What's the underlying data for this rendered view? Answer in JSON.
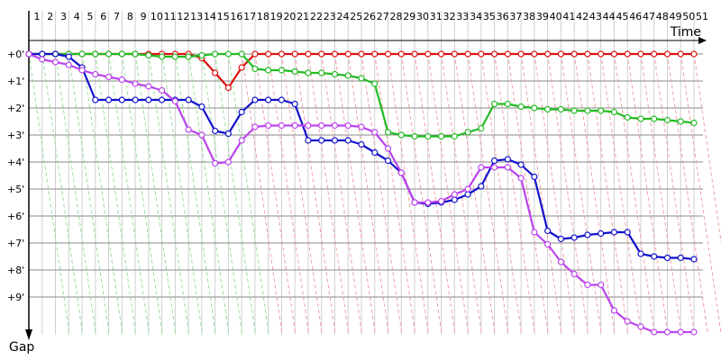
{
  "chart_data": {
    "type": "line",
    "title": "",
    "xlabel": "Time",
    "ylabel": "Gap",
    "x_tick_labels": [
      "1",
      "2",
      "3",
      "4",
      "5",
      "6",
      "7",
      "8",
      "9",
      "10",
      "11",
      "12",
      "13",
      "14",
      "15",
      "16",
      "17",
      "18",
      "19",
      "20",
      "21",
      "22",
      "23",
      "24",
      "25",
      "26",
      "27",
      "28",
      "29",
      "30",
      "31",
      "32",
      "33",
      "34",
      "35",
      "36",
      "37",
      "38",
      "39",
      "40",
      "41",
      "42",
      "43",
      "44",
      "45",
      "46",
      "47",
      "48",
      "49",
      "50",
      "51"
    ],
    "y_tick_labels": [
      "+0'",
      "+1'",
      "+2'",
      "+3'",
      "+4'",
      "+5'",
      "+6'",
      "+7'",
      "+8'",
      "+9'"
    ],
    "xlim": [
      1,
      51
    ],
    "ylim": [
      0,
      10.3
    ],
    "grid": true,
    "legend": "none",
    "series": [
      {
        "color": "#dd1111",
        "x": [
          1,
          2,
          3,
          4,
          5,
          6,
          7,
          8,
          9,
          10,
          11,
          12,
          13,
          14,
          15,
          16,
          17,
          18,
          19,
          20,
          21,
          22,
          23,
          24,
          25,
          26,
          27,
          28,
          29,
          30,
          31,
          32,
          33,
          34,
          35,
          36,
          37,
          38,
          39,
          40,
          41,
          42,
          43,
          44,
          45,
          46,
          47,
          48,
          49,
          50,
          51
        ],
        "values": [
          0,
          0,
          0,
          0,
          0,
          0,
          0,
          0,
          0,
          0,
          0,
          0,
          0,
          0.15,
          0.7,
          1.25,
          0.5,
          0,
          0,
          0,
          0,
          0,
          0,
          0,
          0,
          0,
          0,
          0,
          0,
          0,
          0,
          0,
          0,
          0,
          0,
          0,
          0,
          0,
          0,
          0,
          0,
          0,
          0,
          0,
          0,
          0,
          0,
          0,
          0,
          0,
          0
        ]
      },
      {
        "color": "#22bb22",
        "x": [
          1,
          2,
          3,
          4,
          5,
          6,
          7,
          8,
          9,
          10,
          11,
          12,
          13,
          14,
          15,
          16,
          17,
          18,
          19,
          20,
          21,
          22,
          23,
          24,
          25,
          26,
          27,
          28,
          29,
          30,
          31,
          32,
          33,
          34,
          35,
          36,
          37,
          38,
          39,
          40,
          41,
          42,
          43,
          44,
          45,
          46,
          47,
          48,
          49,
          50,
          51
        ],
        "values": [
          0,
          0,
          0,
          0,
          0,
          0,
          0,
          0,
          0,
          0.05,
          0.1,
          0.1,
          0.1,
          0.05,
          0,
          0,
          0,
          0.55,
          0.6,
          0.6,
          0.65,
          0.7,
          0.7,
          0.75,
          0.8,
          0.9,
          1.1,
          2.9,
          3,
          3.05,
          3.05,
          3.05,
          3.05,
          2.9,
          2.75,
          1.85,
          1.85,
          1.95,
          2,
          2.05,
          2.05,
          2.1,
          2.1,
          2.1,
          2.15,
          2.35,
          2.4,
          2.4,
          2.45,
          2.5,
          2.55
        ]
      },
      {
        "color": "#1111cc",
        "x": [
          1,
          2,
          3,
          4,
          5,
          6,
          7,
          8,
          9,
          10,
          11,
          12,
          13,
          14,
          15,
          16,
          17,
          18,
          19,
          20,
          21,
          22,
          23,
          24,
          25,
          26,
          27,
          28,
          29,
          30,
          31,
          32,
          33,
          34,
          35,
          36,
          37,
          38,
          39,
          40,
          41,
          42,
          43,
          44,
          45,
          46,
          47,
          48,
          49,
          50,
          51
        ],
        "values": [
          0,
          0,
          0,
          0.1,
          0.5,
          1.7,
          1.7,
          1.7,
          1.7,
          1.7,
          1.7,
          1.7,
          1.7,
          1.95,
          2.85,
          2.95,
          2.15,
          1.7,
          1.7,
          1.7,
          1.85,
          3.2,
          3.2,
          3.2,
          3.2,
          3.35,
          3.65,
          3.95,
          4.4,
          5.5,
          5.55,
          5.5,
          5.4,
          5.2,
          4.9,
          3.95,
          3.9,
          4.1,
          4.55,
          6.55,
          6.85,
          6.8,
          6.7,
          6.65,
          6.6,
          6.6,
          7.4,
          7.5,
          7.55,
          7.55,
          7.6
        ]
      },
      {
        "color": "#bb44ee",
        "x": [
          1,
          2,
          3,
          4,
          5,
          6,
          7,
          8,
          9,
          10,
          11,
          12,
          13,
          14,
          15,
          16,
          17,
          18,
          19,
          20,
          21,
          22,
          23,
          24,
          25,
          26,
          27,
          28,
          29,
          30,
          31,
          32,
          33,
          34,
          35,
          36,
          37,
          38,
          39,
          40,
          41,
          42,
          43,
          44,
          45,
          46,
          47,
          48,
          49,
          50,
          51
        ],
        "values": [
          0,
          0.2,
          0.3,
          0.4,
          0.6,
          0.75,
          0.85,
          0.95,
          1.1,
          1.2,
          1.35,
          1.75,
          2.8,
          3,
          4.05,
          4,
          3.2,
          2.7,
          2.65,
          2.65,
          2.65,
          2.65,
          2.65,
          2.65,
          2.65,
          2.7,
          2.9,
          3.5,
          4.4,
          5.5,
          5.5,
          5.45,
          5.2,
          5,
          4.2,
          4.2,
          4.2,
          4.6,
          6.6,
          7.05,
          7.7,
          8.15,
          8.55,
          8.55,
          9.5,
          9.9,
          10.1,
          10.3,
          10.3,
          10.3,
          10.3
        ]
      }
    ]
  }
}
